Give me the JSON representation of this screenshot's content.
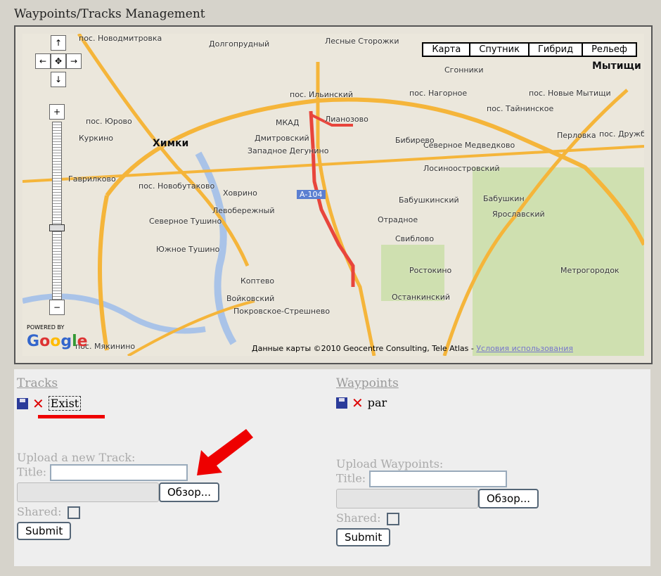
{
  "page_title": "Waypoints/Tracks Management",
  "map": {
    "types": [
      "Карта",
      "Спутник",
      "Гибрид",
      "Рельеф"
    ],
    "nav": {
      "up": "↑",
      "left": "←",
      "center": "✥",
      "right": "→",
      "down": "↓",
      "zoom_in": "+",
      "zoom_out": "−"
    },
    "zoom_level_fraction": 0.55,
    "labels": [
      "пос. Новодмитровка",
      "Долгопрудный",
      "Лесные Сторожки",
      "Мытищи",
      "Сгонники",
      "пос. Нагорное",
      "пос. Ильинский",
      "Лианозово",
      "Химки",
      "пос. Юрово",
      "Куркино",
      "Дмитровский",
      "Западное Дегунино",
      "Бибирево",
      "Северное Медведково",
      "Лосиноостровский",
      "пос. Тайнинское",
      "Перловка",
      "пос. Новые Мытищи",
      "пос. Дружба",
      "Гаврилково",
      "пос. Новобутаково",
      "Ховрино",
      "Левобережный",
      "Бабушкинский",
      "Бабушкин",
      "Ярославский",
      "Северное Тушино",
      "Южное Тушино",
      "Отрадное",
      "Свиблово",
      "Ростокино",
      "Останкинский",
      "Коптево",
      "Войковский",
      "Покровское-Стрешнево",
      "Метрогородок",
      "пос. Мякинино",
      "МКАД",
      "А-104"
    ],
    "copyright": "Данные карты ©2010 Geocentre Consulting, Tele Atlas -",
    "terms_link": "Условия использования",
    "powered_by": "POWERED BY",
    "logo": "Google"
  },
  "tracks": {
    "heading": "Tracks",
    "items": [
      {
        "name": "Exist"
      }
    ],
    "upload_heading": "Upload a new Track:",
    "title_label": "Title:",
    "title_value": "",
    "browse": "Обзор...",
    "shared_label": "Shared:",
    "shared": false,
    "submit": "Submit"
  },
  "waypoints": {
    "heading": "Waypoints",
    "items": [
      {
        "name": "par"
      }
    ],
    "upload_heading": "Upload Waypoints:",
    "title_label": "Title:",
    "title_value": "",
    "browse": "Обзор...",
    "shared_label": "Shared:",
    "shared": false,
    "submit": "Submit"
  },
  "colors": {
    "track": "#e8453c",
    "annotation": "#ee0000",
    "road": "#f5b53a"
  }
}
